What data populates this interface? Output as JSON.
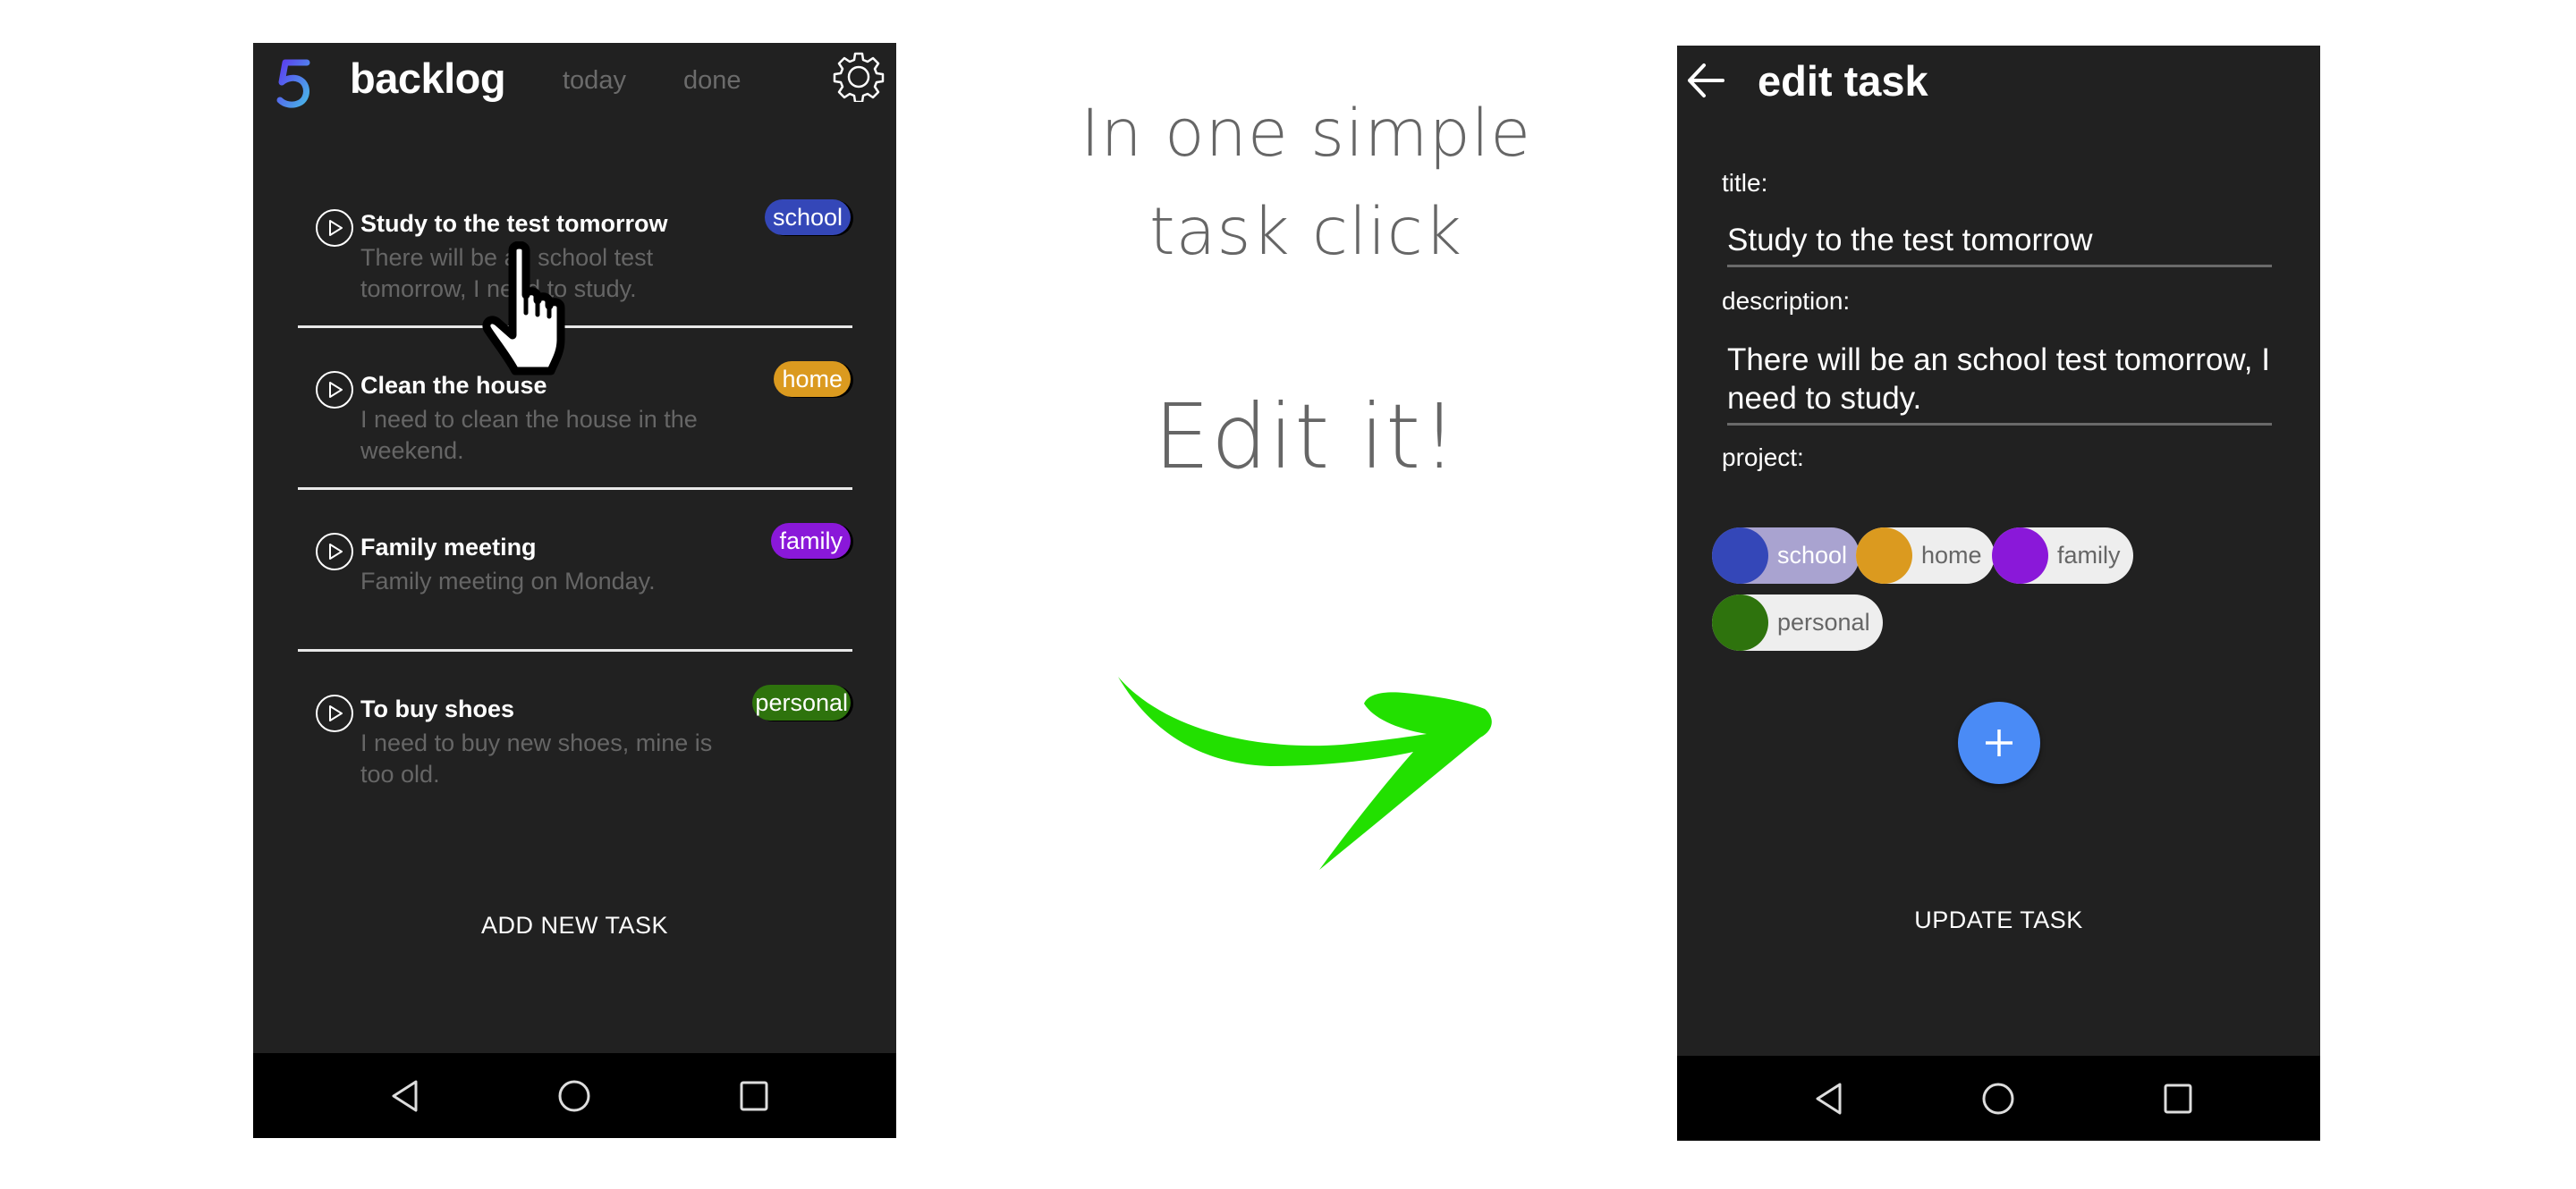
{
  "left_screen": {
    "logo_glyph": "5",
    "app_title": "backlog",
    "tabs": [
      {
        "label": "today"
      },
      {
        "label": "done"
      }
    ],
    "settings_icon": "gear-icon",
    "tasks": [
      {
        "title": "Study to the test tomorrow",
        "description": "There will be an school test tomorrow, I need to study.",
        "project": "school",
        "project_color": "#3447b8"
      },
      {
        "title": "Clean the house",
        "description": "I need to clean the house in the weekend.",
        "project": "home",
        "project_color": "#db9a1f"
      },
      {
        "title": "Family meeting",
        "description": "Family meeting on Monday.",
        "project": "family",
        "project_color": "#8a18d9"
      },
      {
        "title": "To buy shoes",
        "description": "I need to buy new shoes, mine is too old.",
        "project": "personal",
        "project_color": "#2e730d"
      }
    ],
    "add_task_label": "ADD NEW TASK",
    "cursor_icon": "hand-pointer-icon"
  },
  "middle": {
    "caption_line1": "In one simple",
    "caption_line2": "task click",
    "caption_big": "Edit it!",
    "arrow_color": "#22e000"
  },
  "right_screen": {
    "title": "edit task",
    "fields": {
      "title_label": "title:",
      "title_value": "Study to the test tomorrow",
      "description_label": "description:",
      "description_value": "There will be an school test tomorrow, I need to study.",
      "project_label": "project:"
    },
    "projects": [
      {
        "label": "school",
        "color": "#3447b8",
        "selected": true
      },
      {
        "label": "home",
        "color": "#db9a1f",
        "selected": false
      },
      {
        "label": "family",
        "color": "#8a18d9",
        "selected": false
      },
      {
        "label": "personal",
        "color": "#2e730d",
        "selected": false
      }
    ],
    "fab_icon": "plus-icon",
    "fab_color": "#4a8bf6",
    "update_task_label": "UPDATE TASK"
  },
  "system_nav": [
    "back",
    "home",
    "recents"
  ]
}
